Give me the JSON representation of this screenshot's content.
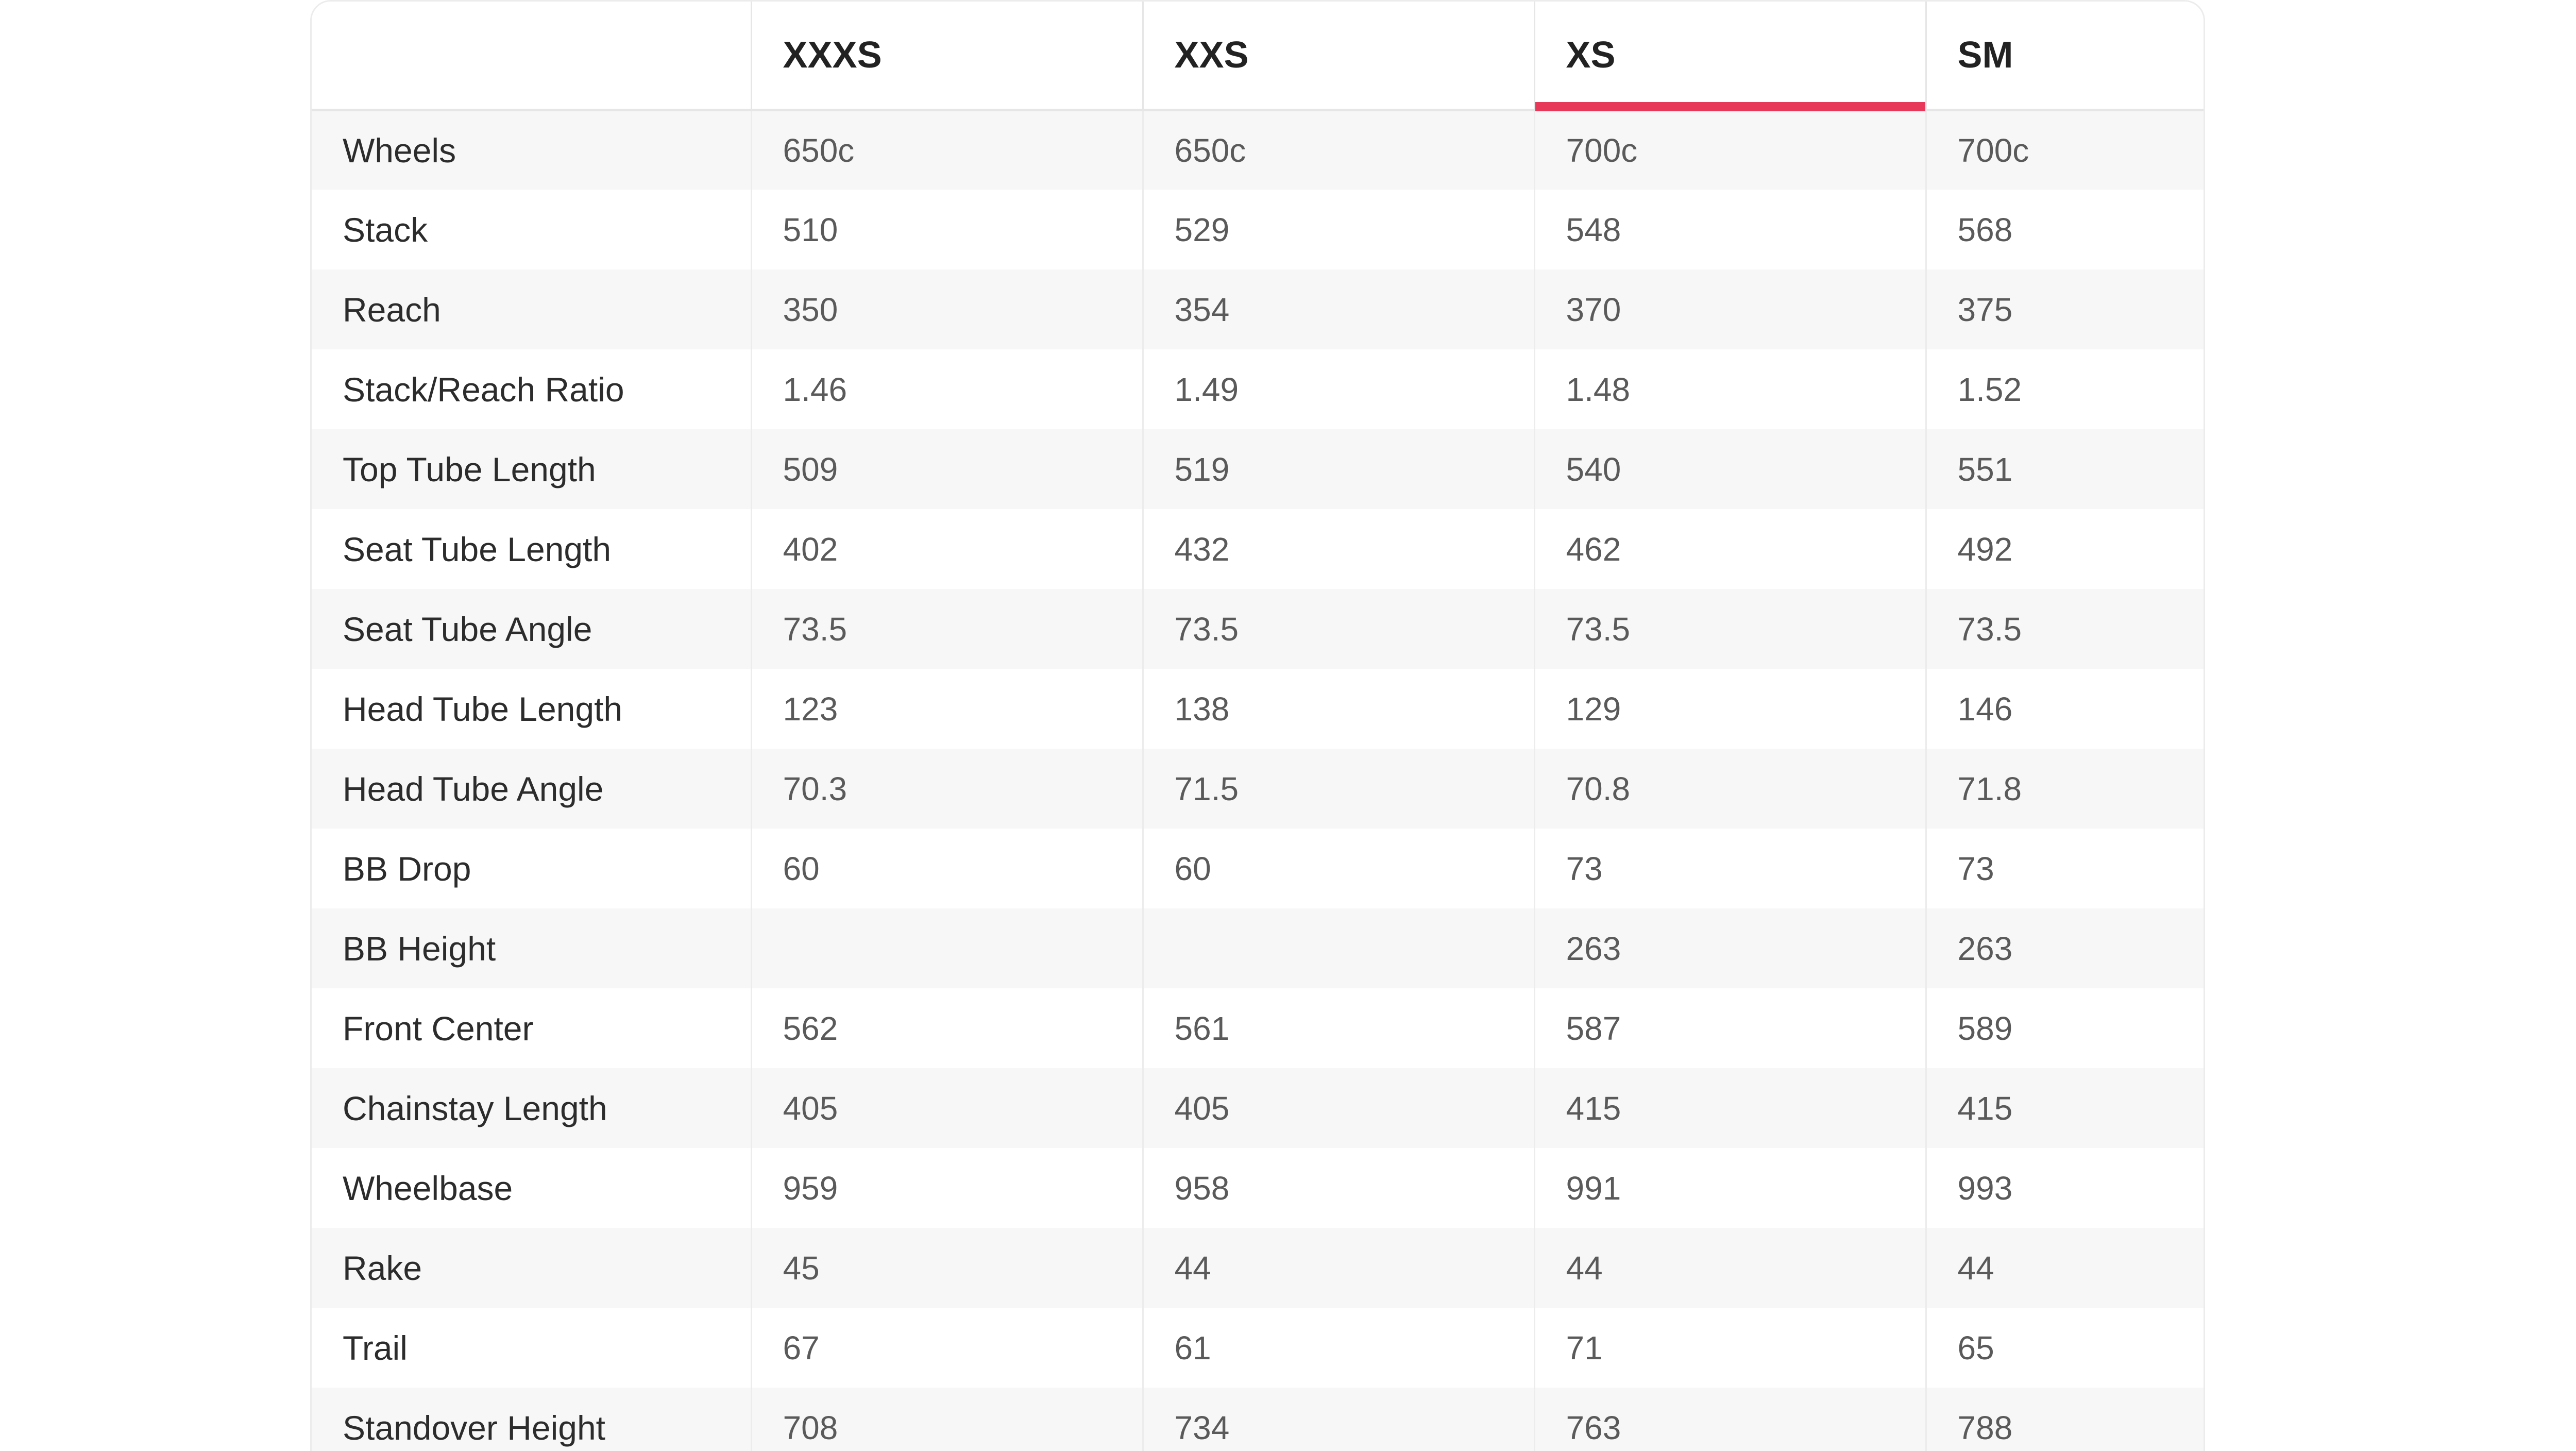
{
  "geometry_table": {
    "columns": [
      "",
      "XXXS",
      "XXS",
      "XS",
      "SM"
    ],
    "active_column": "XS",
    "accent_color": "#e8385a",
    "rows": [
      {
        "label": "Wheels",
        "values": [
          "650c",
          "650c",
          "700c",
          "700c"
        ]
      },
      {
        "label": "Stack",
        "values": [
          "510",
          "529",
          "548",
          "568"
        ]
      },
      {
        "label": "Reach",
        "values": [
          "350",
          "354",
          "370",
          "375"
        ]
      },
      {
        "label": "Stack/Reach Ratio",
        "values": [
          "1.46",
          "1.49",
          "1.48",
          "1.52"
        ]
      },
      {
        "label": "Top Tube Length",
        "values": [
          "509",
          "519",
          "540",
          "551"
        ]
      },
      {
        "label": "Seat Tube Length",
        "values": [
          "402",
          "432",
          "462",
          "492"
        ]
      },
      {
        "label": "Seat Tube Angle",
        "values": [
          "73.5",
          "73.5",
          "73.5",
          "73.5"
        ]
      },
      {
        "label": "Head Tube Length",
        "values": [
          "123",
          "138",
          "129",
          "146"
        ]
      },
      {
        "label": "Head Tube Angle",
        "values": [
          "70.3",
          "71.5",
          "70.8",
          "71.8"
        ]
      },
      {
        "label": "BB Drop",
        "values": [
          "60",
          "60",
          "73",
          "73"
        ]
      },
      {
        "label": "BB Height",
        "values": [
          "",
          "",
          "263",
          "263"
        ]
      },
      {
        "label": "Front Center",
        "values": [
          "562",
          "561",
          "587",
          "589"
        ]
      },
      {
        "label": "Chainstay Length",
        "values": [
          "405",
          "405",
          "415",
          "415"
        ]
      },
      {
        "label": "Wheelbase",
        "values": [
          "959",
          "958",
          "991",
          "993"
        ]
      },
      {
        "label": "Rake",
        "values": [
          "45",
          "44",
          "44",
          "44"
        ]
      },
      {
        "label": "Trail",
        "values": [
          "67",
          "61",
          "71",
          "65"
        ]
      },
      {
        "label": "Standover Height",
        "values": [
          "708",
          "734",
          "763",
          "788"
        ]
      }
    ]
  }
}
